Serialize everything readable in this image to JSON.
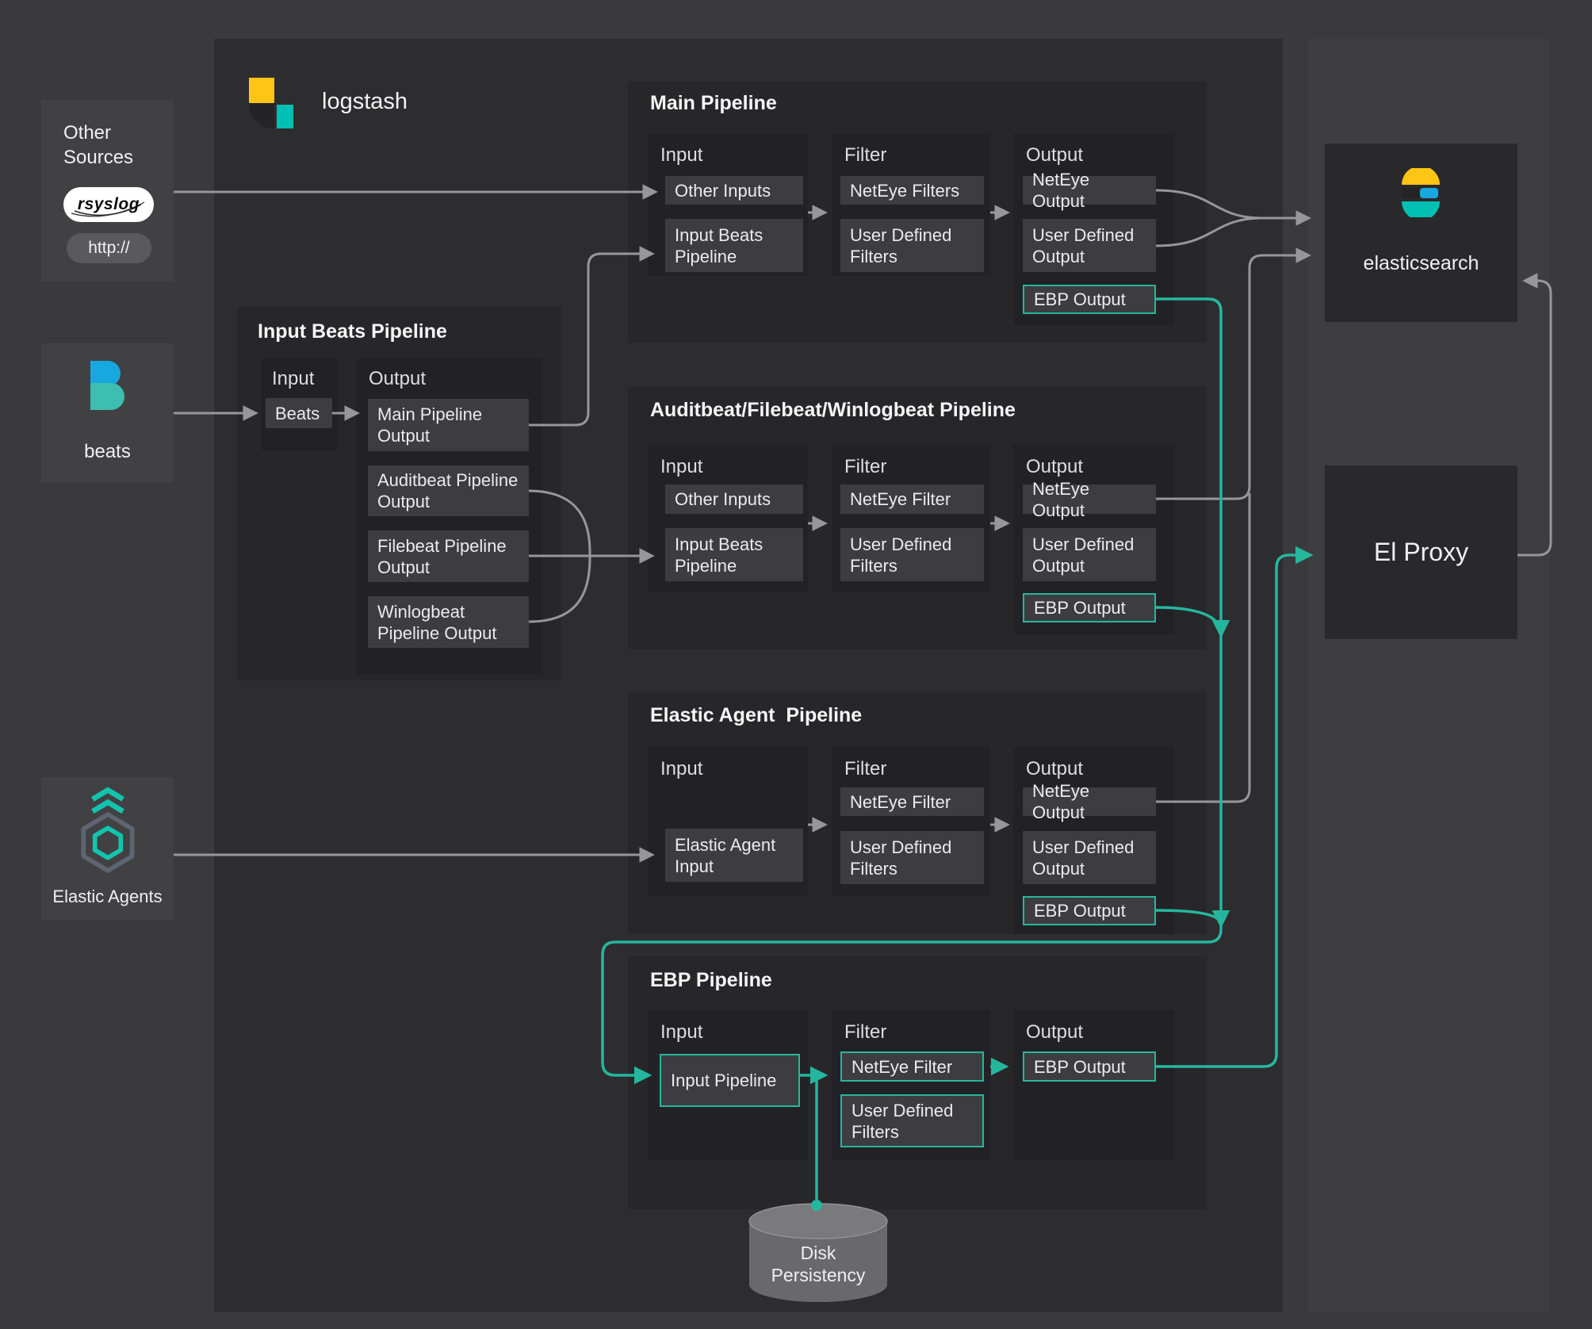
{
  "headers": {
    "input": "Input",
    "filter": "Filter",
    "output": "Output"
  },
  "logstash": {
    "brand": "logstash"
  },
  "sources": {
    "other": {
      "title": "Other Sources",
      "rsyslog_label": "rsyslog",
      "http_label": "http://"
    },
    "beats": {
      "label": "beats"
    },
    "elastic_agents": {
      "label": "Elastic Agents"
    }
  },
  "pipelines": {
    "main": {
      "title": "Main Pipeline",
      "inputs": [
        "Other Inputs",
        "Input Beats Pipeline"
      ],
      "filters": [
        "NetEye Filters",
        "User Defined Filters"
      ],
      "outputs": [
        "NetEye Output",
        "User Defined Output",
        "EBP Output"
      ]
    },
    "input_beats": {
      "title": "Input Beats Pipeline",
      "inputs": [
        "Beats"
      ],
      "outputs": [
        "Main Pipeline Output",
        "Auditbeat Pipeline Output",
        "Filebeat Pipeline Output",
        "Winlogbeat Pipeline Output"
      ]
    },
    "abw": {
      "title": "Auditbeat/Filebeat/Winlogbeat Pipeline",
      "inputs": [
        "Other Inputs",
        "Input Beats Pipeline"
      ],
      "filters": [
        "NetEye Filter",
        "User Defined Filters"
      ],
      "outputs": [
        "NetEye Output",
        "User Defined Output",
        "EBP Output"
      ]
    },
    "elastic_agent": {
      "title": "Elastic Agent  Pipeline",
      "inputs": [
        "Elastic Agent Input"
      ],
      "filters": [
        "NetEye Filter",
        "User Defined Filters"
      ],
      "outputs": [
        "NetEye Output",
        "User Defined Output",
        "EBP Output"
      ]
    },
    "ebp": {
      "title": "EBP Pipeline",
      "inputs": [
        "Input Pipeline"
      ],
      "filters": [
        "NetEye Filter",
        "User Defined Filters"
      ],
      "outputs": [
        "EBP Output"
      ]
    }
  },
  "targets": {
    "elasticsearch": {
      "label": "elasticsearch"
    },
    "el_proxy": {
      "label": "El Proxy"
    },
    "disk": {
      "label": "Disk Persistency"
    }
  },
  "colors": {
    "accent_teal": "#25b79d",
    "line_gray": "#97979a",
    "elastic_yellow": "#fec514",
    "elastic_blue": "#18a8e0",
    "elastic_teal": "#00bfb3"
  }
}
